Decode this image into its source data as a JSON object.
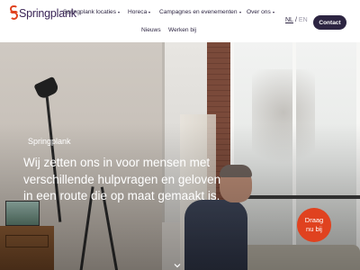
{
  "header": {
    "logo_text": "Springplank",
    "nav": [
      {
        "label": "Springplank locaties",
        "dropdown": true
      },
      {
        "label": "Horeca",
        "dropdown": true
      },
      {
        "label": "Campagnes en evenementen",
        "dropdown": true
      },
      {
        "label": "Over ons",
        "dropdown": true
      },
      {
        "label": "Nieuws",
        "dropdown": false
      },
      {
        "label": "Werken bij",
        "dropdown": false
      }
    ],
    "lang": {
      "nl": "NL",
      "separator": "/",
      "en": "EN"
    },
    "contact_label": "Contact"
  },
  "hero": {
    "label": "Springplank",
    "headline_lines": [
      "Wij zetten ons in voor mensen met",
      "verschillende hulpvragen en geloven",
      "in een route die op maat gemaakt is."
    ],
    "drag_lines": [
      "Draag",
      "nu bij"
    ],
    "scroll_icon": "chevron-down-icon"
  },
  "colors": {
    "brand_orange": "#e0421f",
    "brand_navy": "#2d2542"
  }
}
